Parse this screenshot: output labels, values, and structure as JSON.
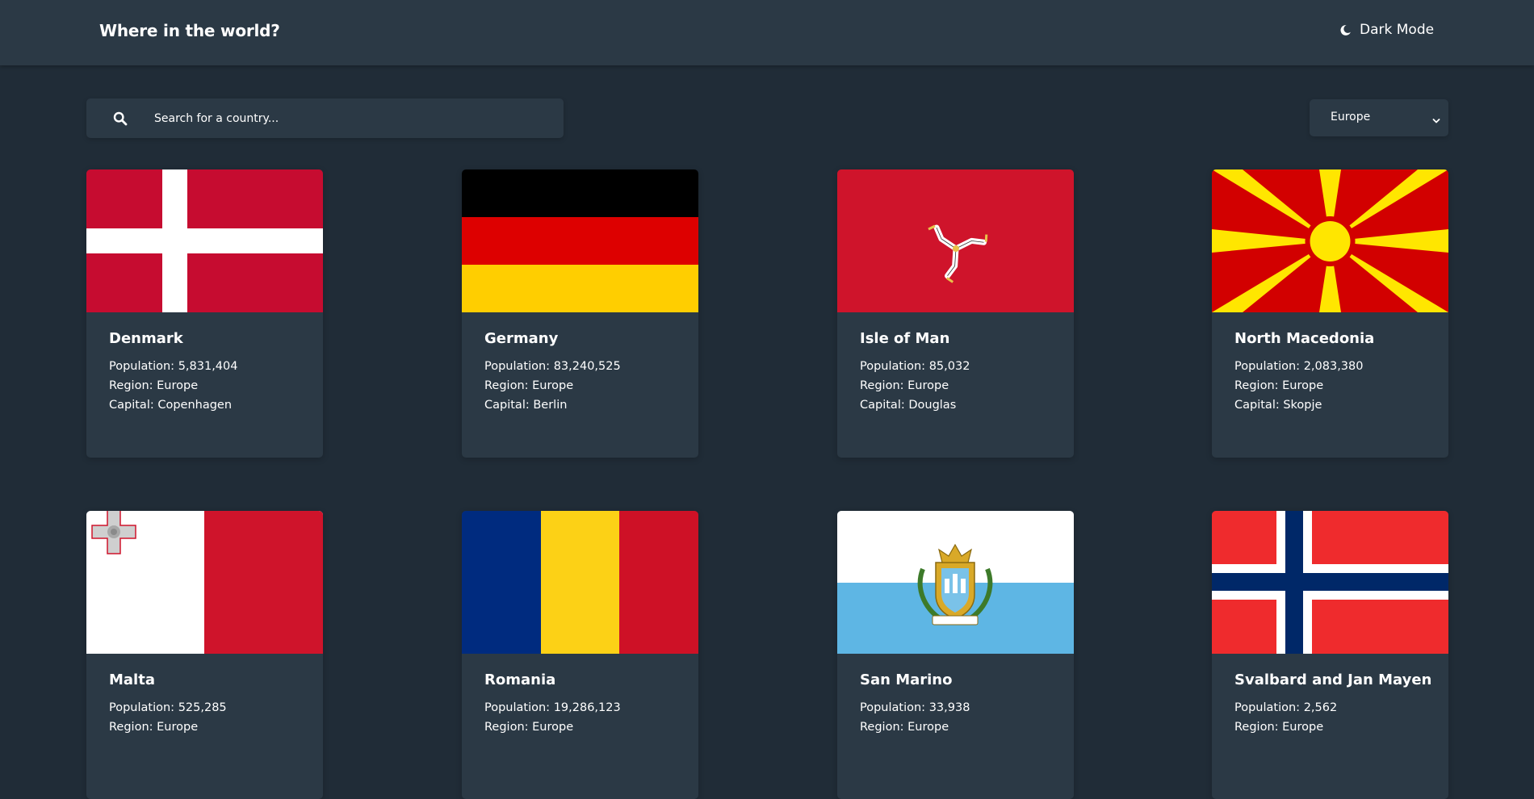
{
  "header": {
    "title": "Where in the world?",
    "mode_label": "Dark Mode",
    "mode_icon": "moon-icon"
  },
  "search": {
    "placeholder": "Search for a country...",
    "value": "",
    "icon": "search-icon"
  },
  "filter": {
    "selected": "Europe",
    "icon": "chevron-down-icon"
  },
  "labels": {
    "population": "Population:",
    "region": "Region:",
    "capital": "Capital:"
  },
  "countries": [
    {
      "name": "Denmark",
      "population": "5,831,404",
      "region": "Europe",
      "capital": "Copenhagen",
      "flag": "denmark-flag"
    },
    {
      "name": "Germany",
      "population": "83,240,525",
      "region": "Europe",
      "capital": "Berlin",
      "flag": "germany-flag"
    },
    {
      "name": "Isle of Man",
      "population": "85,032",
      "region": "Europe",
      "capital": "Douglas",
      "flag": "isle-of-man-flag"
    },
    {
      "name": "North Macedonia",
      "population": "2,083,380",
      "region": "Europe",
      "capital": "Skopje",
      "flag": "north-macedonia-flag"
    },
    {
      "name": "Malta",
      "population": "525,285",
      "region": "Europe",
      "capital": "",
      "flag": "malta-flag"
    },
    {
      "name": "Romania",
      "population": "19,286,123",
      "region": "Europe",
      "capital": "",
      "flag": "romania-flag"
    },
    {
      "name": "San Marino",
      "population": "33,938",
      "region": "Europe",
      "capital": "",
      "flag": "san-marino-flag"
    },
    {
      "name": "Svalbard and Jan Mayen",
      "population": "2,562",
      "region": "Europe",
      "capital": "",
      "flag": "svalbard-and-jan-mayen-flag"
    }
  ],
  "colors": {
    "background": "#202c37",
    "element": "#2b3945",
    "text": "#ffffff"
  }
}
